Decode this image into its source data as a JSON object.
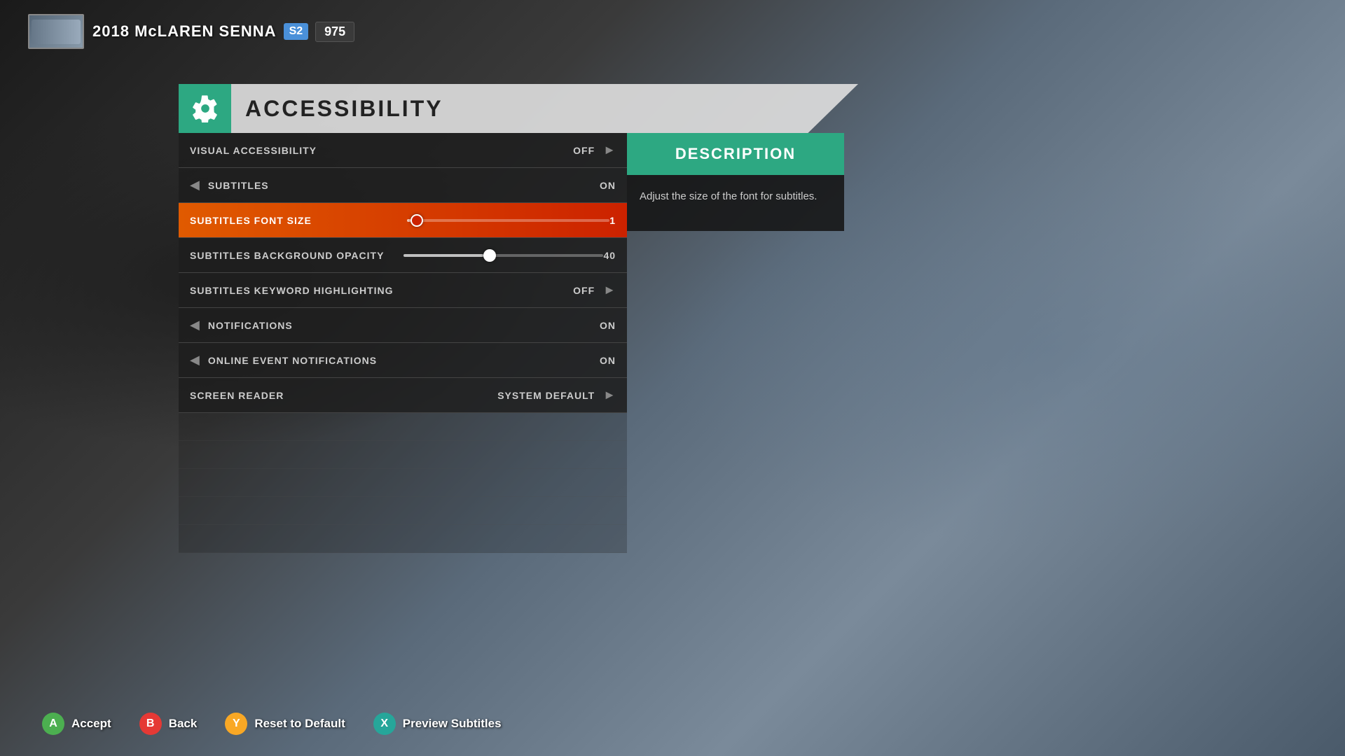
{
  "background": {
    "color1": "#1a1a1a",
    "color2": "#5a6a7a"
  },
  "hud": {
    "car_year": "2018",
    "car_make": "McLAREN",
    "car_model": "SENNA",
    "badge_class": "S2",
    "badge_pi": "975"
  },
  "title": {
    "text": "ACCESSIBILITY",
    "icon": "gear"
  },
  "settings": [
    {
      "label": "VISUAL ACCESSIBILITY",
      "value": "OFF",
      "type": "arrow",
      "active": false,
      "dim": false
    },
    {
      "label": "SUBTITLES",
      "value": "ON",
      "type": "arrow-left",
      "active": false,
      "dim": false
    },
    {
      "label": "SUBTITLES FONT SIZE",
      "value": "1",
      "type": "slider",
      "slider_pct": 2,
      "active": true,
      "dim": false
    },
    {
      "label": "SUBTITLES BACKGROUND OPACITY",
      "value": "40",
      "type": "slider",
      "slider_pct": 40,
      "active": false,
      "dim": false
    },
    {
      "label": "SUBTITLES KEYWORD HIGHLIGHTING",
      "value": "OFF",
      "type": "arrow",
      "active": false,
      "dim": false
    },
    {
      "label": "NOTIFICATIONS",
      "value": "ON",
      "type": "arrow-left",
      "active": false,
      "dim": false
    },
    {
      "label": "ONLINE EVENT NOTIFICATIONS",
      "value": "ON",
      "type": "arrow-left",
      "active": false,
      "dim": false
    },
    {
      "label": "SCREEN READER",
      "value": "SYSTEM DEFAULT",
      "type": "arrow",
      "active": false,
      "dim": false
    }
  ],
  "description": {
    "header": "DESCRIPTION",
    "body": "Adjust the size of the font for subtitles."
  },
  "actions": [
    {
      "button": "A",
      "label": "Accept",
      "color": "green"
    },
    {
      "button": "B",
      "label": "Back",
      "color": "red"
    },
    {
      "button": "Y",
      "label": "Reset to Default",
      "color": "yellow"
    },
    {
      "button": "X",
      "label": "Preview Subtitles",
      "color": "teal"
    }
  ]
}
